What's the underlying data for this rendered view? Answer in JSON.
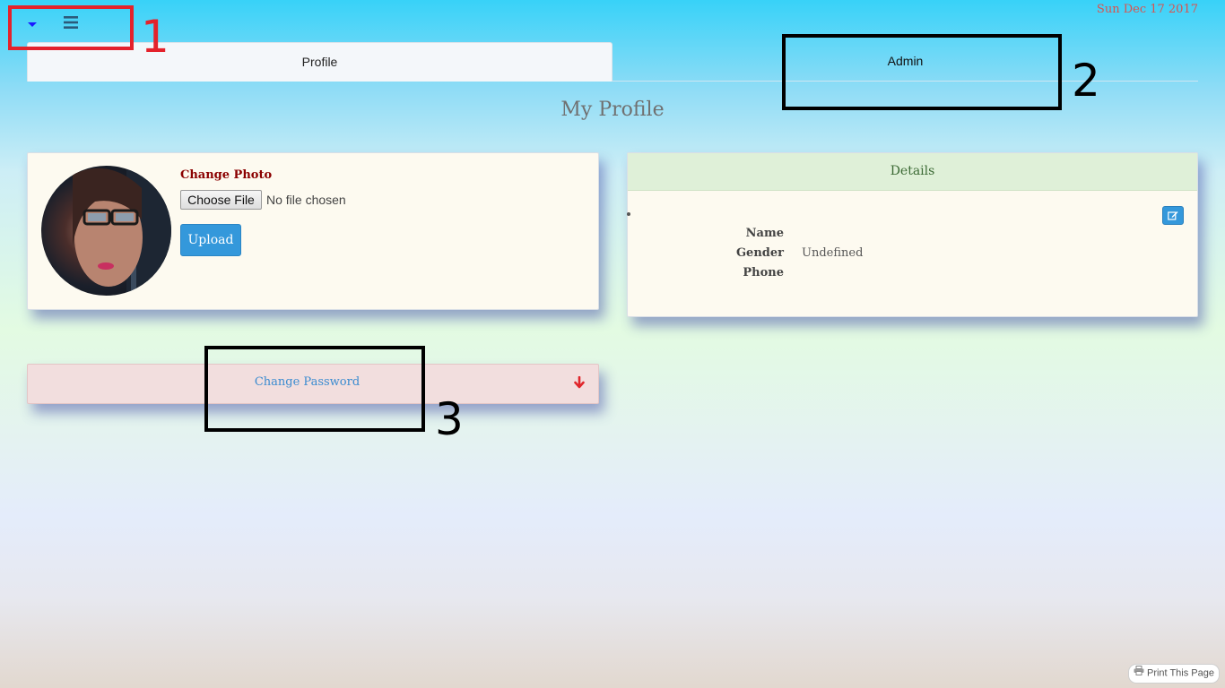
{
  "header": {
    "date": "Sun Dec 17 2017",
    "caret_icon": "caret-down-icon",
    "menu_icon": "hamburger-menu-icon"
  },
  "tabs": [
    {
      "label": "Profile",
      "active": true
    },
    {
      "label": "Admin",
      "active": false
    }
  ],
  "page_title": "My Profile",
  "photo_card": {
    "change_photo_label": "Change Photo",
    "choose_file_label": "Choose File",
    "no_file_text": "No file chosen",
    "upload_label": "Upload"
  },
  "details_card": {
    "header": "Details",
    "edit_icon": "edit-icon",
    "fields": [
      {
        "label": "Name",
        "value": ""
      },
      {
        "label": "Gender",
        "value": "Undefined"
      },
      {
        "label": "Phone",
        "value": ""
      }
    ]
  },
  "password_panel": {
    "label": "Change Password",
    "arrow_icon": "arrow-down-icon"
  },
  "annotations": [
    "1",
    "2",
    "3"
  ],
  "print_button": {
    "label": "Print This Page",
    "icon": "printer-icon"
  },
  "colors": {
    "accent_blue": "#3498db",
    "date_red": "#d9534f",
    "details_header_bg": "#dff0d8",
    "password_bg": "#f2dede",
    "annotation_red": "#e4222b"
  }
}
